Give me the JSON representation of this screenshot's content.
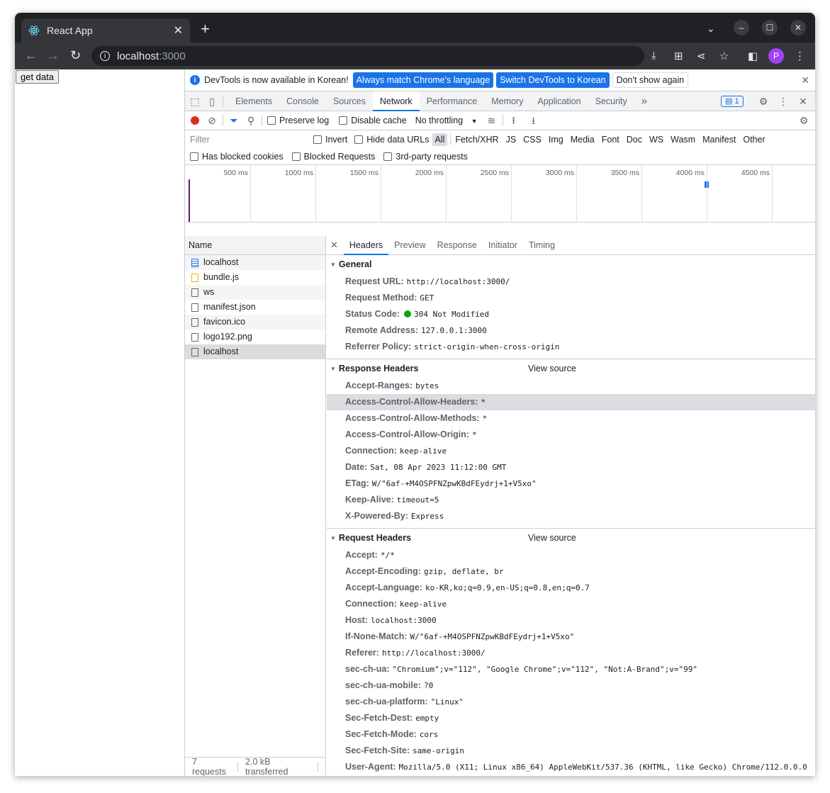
{
  "browser": {
    "tab_title": "React App",
    "url_host": "localhost",
    "url_port": ":3000",
    "avatar_letter": "P"
  },
  "page": {
    "button_label": "get data"
  },
  "devtools": {
    "infobar": {
      "message": "DevTools is now available in Korean!",
      "btn_match": "Always match Chrome's language",
      "btn_switch": "Switch DevTools to Korean",
      "btn_dismiss": "Don't show again"
    },
    "tabs": [
      "Elements",
      "Console",
      "Sources",
      "Network",
      "Performance",
      "Memory",
      "Application",
      "Security"
    ],
    "active_tab": "Network",
    "more_tabs": "»",
    "issues_count": "1",
    "network_toolbar": {
      "preserve_log": "Preserve log",
      "disable_cache": "Disable cache",
      "throttling": "No throttling"
    },
    "filter": {
      "placeholder": "Filter",
      "invert": "Invert",
      "hide_data_urls": "Hide data URLs",
      "types": [
        "All",
        "Fetch/XHR",
        "JS",
        "CSS",
        "Img",
        "Media",
        "Font",
        "Doc",
        "WS",
        "Wasm",
        "Manifest",
        "Other"
      ],
      "has_blocked_cookies": "Has blocked cookies",
      "blocked_requests": "Blocked Requests",
      "third_party": "3rd-party requests"
    },
    "timeline": [
      "500 ms",
      "1000 ms",
      "1500 ms",
      "2000 ms",
      "2500 ms",
      "3000 ms",
      "3500 ms",
      "4000 ms",
      "4500 ms",
      "5"
    ],
    "requests": {
      "header": "Name",
      "items": [
        {
          "name": "localhost",
          "type": "doc"
        },
        {
          "name": "bundle.js",
          "type": "js"
        },
        {
          "name": "ws",
          "type": "plain"
        },
        {
          "name": "manifest.json",
          "type": "plain"
        },
        {
          "name": "favicon.ico",
          "type": "plain"
        },
        {
          "name": "logo192.png",
          "type": "plain"
        },
        {
          "name": "localhost",
          "type": "plain"
        }
      ],
      "footer_count": "7 requests",
      "footer_transferred": "2.0 kB transferred"
    },
    "detail_tabs": [
      "Headers",
      "Preview",
      "Response",
      "Initiator",
      "Timing"
    ],
    "general": {
      "title": "General",
      "rows": [
        {
          "name": "Request URL:",
          "value": "http://localhost:3000/"
        },
        {
          "name": "Request Method:",
          "value": "GET"
        },
        {
          "name": "Status Code:",
          "value": "304 Not Modified"
        },
        {
          "name": "Remote Address:",
          "value": "127.0.0.1:3000"
        },
        {
          "name": "Referrer Policy:",
          "value": "strict-origin-when-cross-origin"
        }
      ]
    },
    "response_headers": {
      "title": "Response Headers",
      "view_source": "View source",
      "rows": [
        {
          "name": "Accept-Ranges:",
          "value": "bytes"
        },
        {
          "name": "Access-Control-Allow-Headers:",
          "value": "*"
        },
        {
          "name": "Access-Control-Allow-Methods:",
          "value": "*"
        },
        {
          "name": "Access-Control-Allow-Origin:",
          "value": "*"
        },
        {
          "name": "Connection:",
          "value": "keep-alive"
        },
        {
          "name": "Date:",
          "value": "Sat, 08 Apr 2023 11:12:00 GMT"
        },
        {
          "name": "ETag:",
          "value": "W/\"6af-+M4OSPFNZpwKBdFEydrj+1+V5xo\""
        },
        {
          "name": "Keep-Alive:",
          "value": "timeout=5"
        },
        {
          "name": "X-Powered-By:",
          "value": "Express"
        }
      ]
    },
    "request_headers": {
      "title": "Request Headers",
      "view_source": "View source",
      "rows": [
        {
          "name": "Accept:",
          "value": "*/*"
        },
        {
          "name": "Accept-Encoding:",
          "value": "gzip, deflate, br"
        },
        {
          "name": "Accept-Language:",
          "value": "ko-KR,ko;q=0.9,en-US;q=0.8,en;q=0.7"
        },
        {
          "name": "Connection:",
          "value": "keep-alive"
        },
        {
          "name": "Host:",
          "value": "localhost:3000"
        },
        {
          "name": "If-None-Match:",
          "value": "W/\"6af-+M4OSPFNZpwKBdFEydrj+1+V5xo\""
        },
        {
          "name": "Referer:",
          "value": "http://localhost:3000/"
        },
        {
          "name": "sec-ch-ua:",
          "value": "\"Chromium\";v=\"112\", \"Google Chrome\";v=\"112\", \"Not:A-Brand\";v=\"99\""
        },
        {
          "name": "sec-ch-ua-mobile:",
          "value": "?0"
        },
        {
          "name": "sec-ch-ua-platform:",
          "value": "\"Linux\""
        },
        {
          "name": "Sec-Fetch-Dest:",
          "value": "empty"
        },
        {
          "name": "Sec-Fetch-Mode:",
          "value": "cors"
        },
        {
          "name": "Sec-Fetch-Site:",
          "value": "same-origin"
        },
        {
          "name": "User-Agent:",
          "value": "Mozilla/5.0 (X11; Linux x86_64) AppleWebKit/537.36 (KHTML, like Gecko) Chrome/112.0.0.0"
        },
        {
          "name": "",
          "value": "Safari/537.36"
        }
      ]
    }
  }
}
